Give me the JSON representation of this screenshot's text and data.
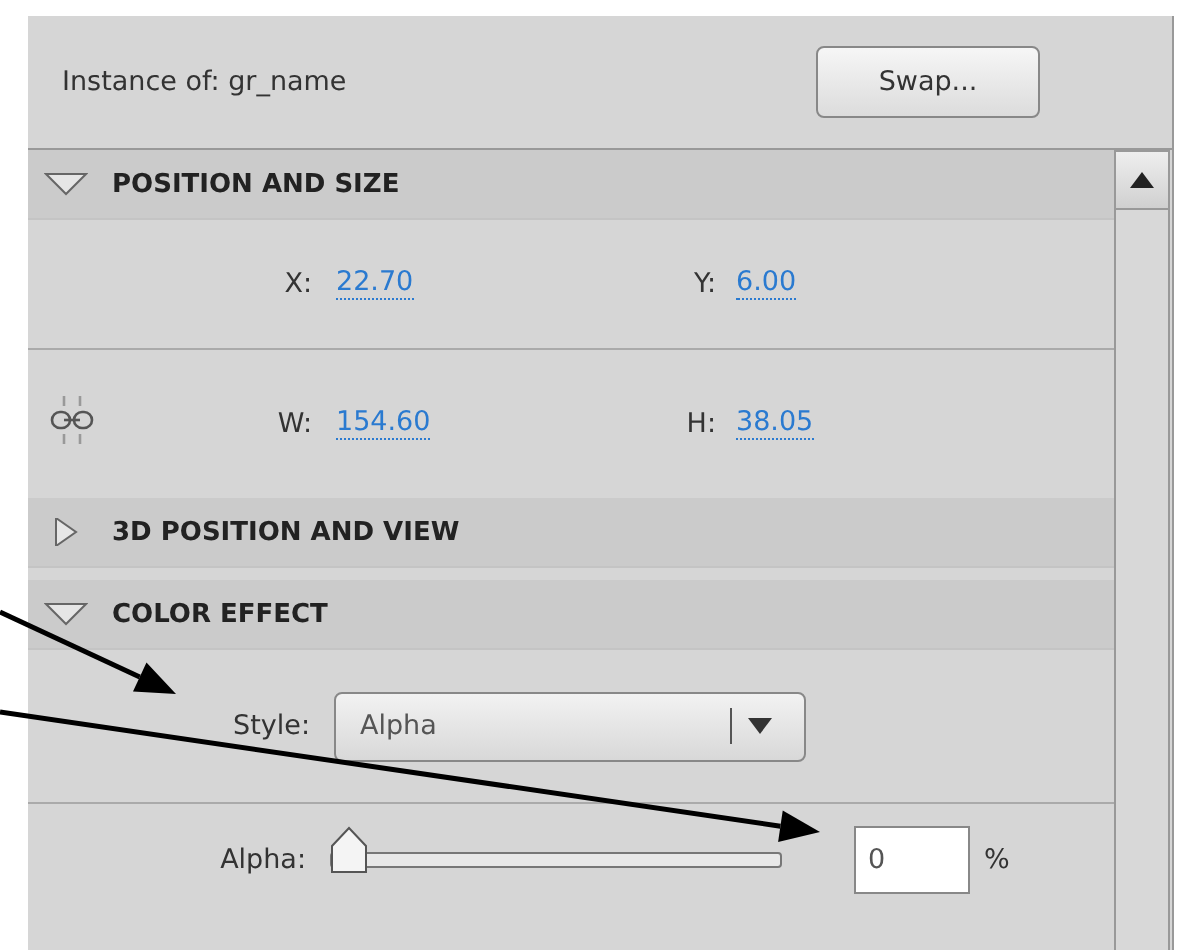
{
  "instance": {
    "label": "Instance of:",
    "value": "gr_name"
  },
  "swap_button": "Swap...",
  "sections": [
    {
      "title": "POSITION AND SIZE",
      "expanded": true,
      "kind": "geometry",
      "rows": [
        {
          "kind": "plain",
          "fields": [
            {
              "label": "X:",
              "value": "22.70"
            },
            {
              "label": "Y:",
              "value": "6.00"
            }
          ]
        },
        {
          "kind": "constrain",
          "fields": [
            {
              "label": "W:",
              "value": "154.60"
            },
            {
              "label": "H:",
              "value": "38.05"
            }
          ]
        }
      ]
    },
    {
      "title": "3D POSITION AND VIEW",
      "expanded": false
    },
    {
      "title": "COLOR EFFECT",
      "expanded": true,
      "kind": "color",
      "style": {
        "label": "Style:",
        "value": "Alpha"
      },
      "alpha": {
        "label": "Alpha:",
        "level": 0,
        "value": "0",
        "unit": "%"
      }
    }
  ]
}
